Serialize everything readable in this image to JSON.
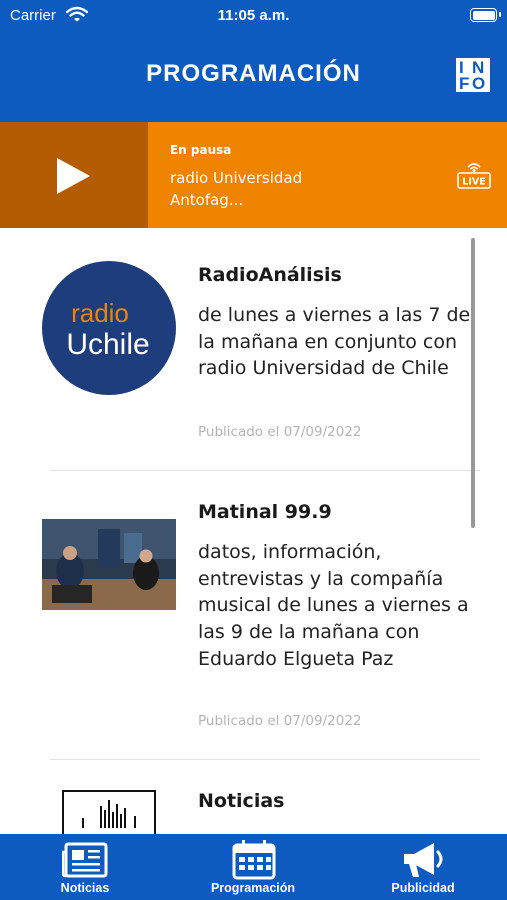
{
  "status_bar": {
    "carrier": "Carrier",
    "time": "11:05 a.m."
  },
  "header": {
    "title": "PROGRAMACIÓN",
    "info_icon": "info-icon",
    "info_letters": [
      "I",
      "N",
      "F",
      "O"
    ]
  },
  "player": {
    "state": "En pausa",
    "station": "radio Universidad Antofag...",
    "play_icon": "play-icon",
    "live_label": "LIVE"
  },
  "programs": [
    {
      "logo_text_1": "radio",
      "logo_text_2": "Uchile",
      "title": "RadioAnálisis",
      "description": "de lunes a viernes a las 7 de la mañana en conjunto con radio Universidad de Chile",
      "date": "Publicado el 07/09/2022"
    },
    {
      "title": "Matinal 99.9",
      "description": "datos, información, entrevistas y la compañía musical de lunes a viernes a las 9 de la mañana con Eduardo Elgueta Paz",
      "date": "Publicado el 07/09/2022"
    },
    {
      "title": "Noticias"
    }
  ],
  "tabbar": {
    "tabs": [
      {
        "label": "Noticias",
        "icon": "newspaper-icon"
      },
      {
        "label": "Programación",
        "icon": "calendar-icon"
      },
      {
        "label": "Publicidad",
        "icon": "megaphone-icon"
      }
    ]
  },
  "colors": {
    "header_blue": "#0d5bbf",
    "player_orange": "#f08300",
    "player_dark": "#b45c03",
    "logo_navy": "#1d3d7c"
  }
}
